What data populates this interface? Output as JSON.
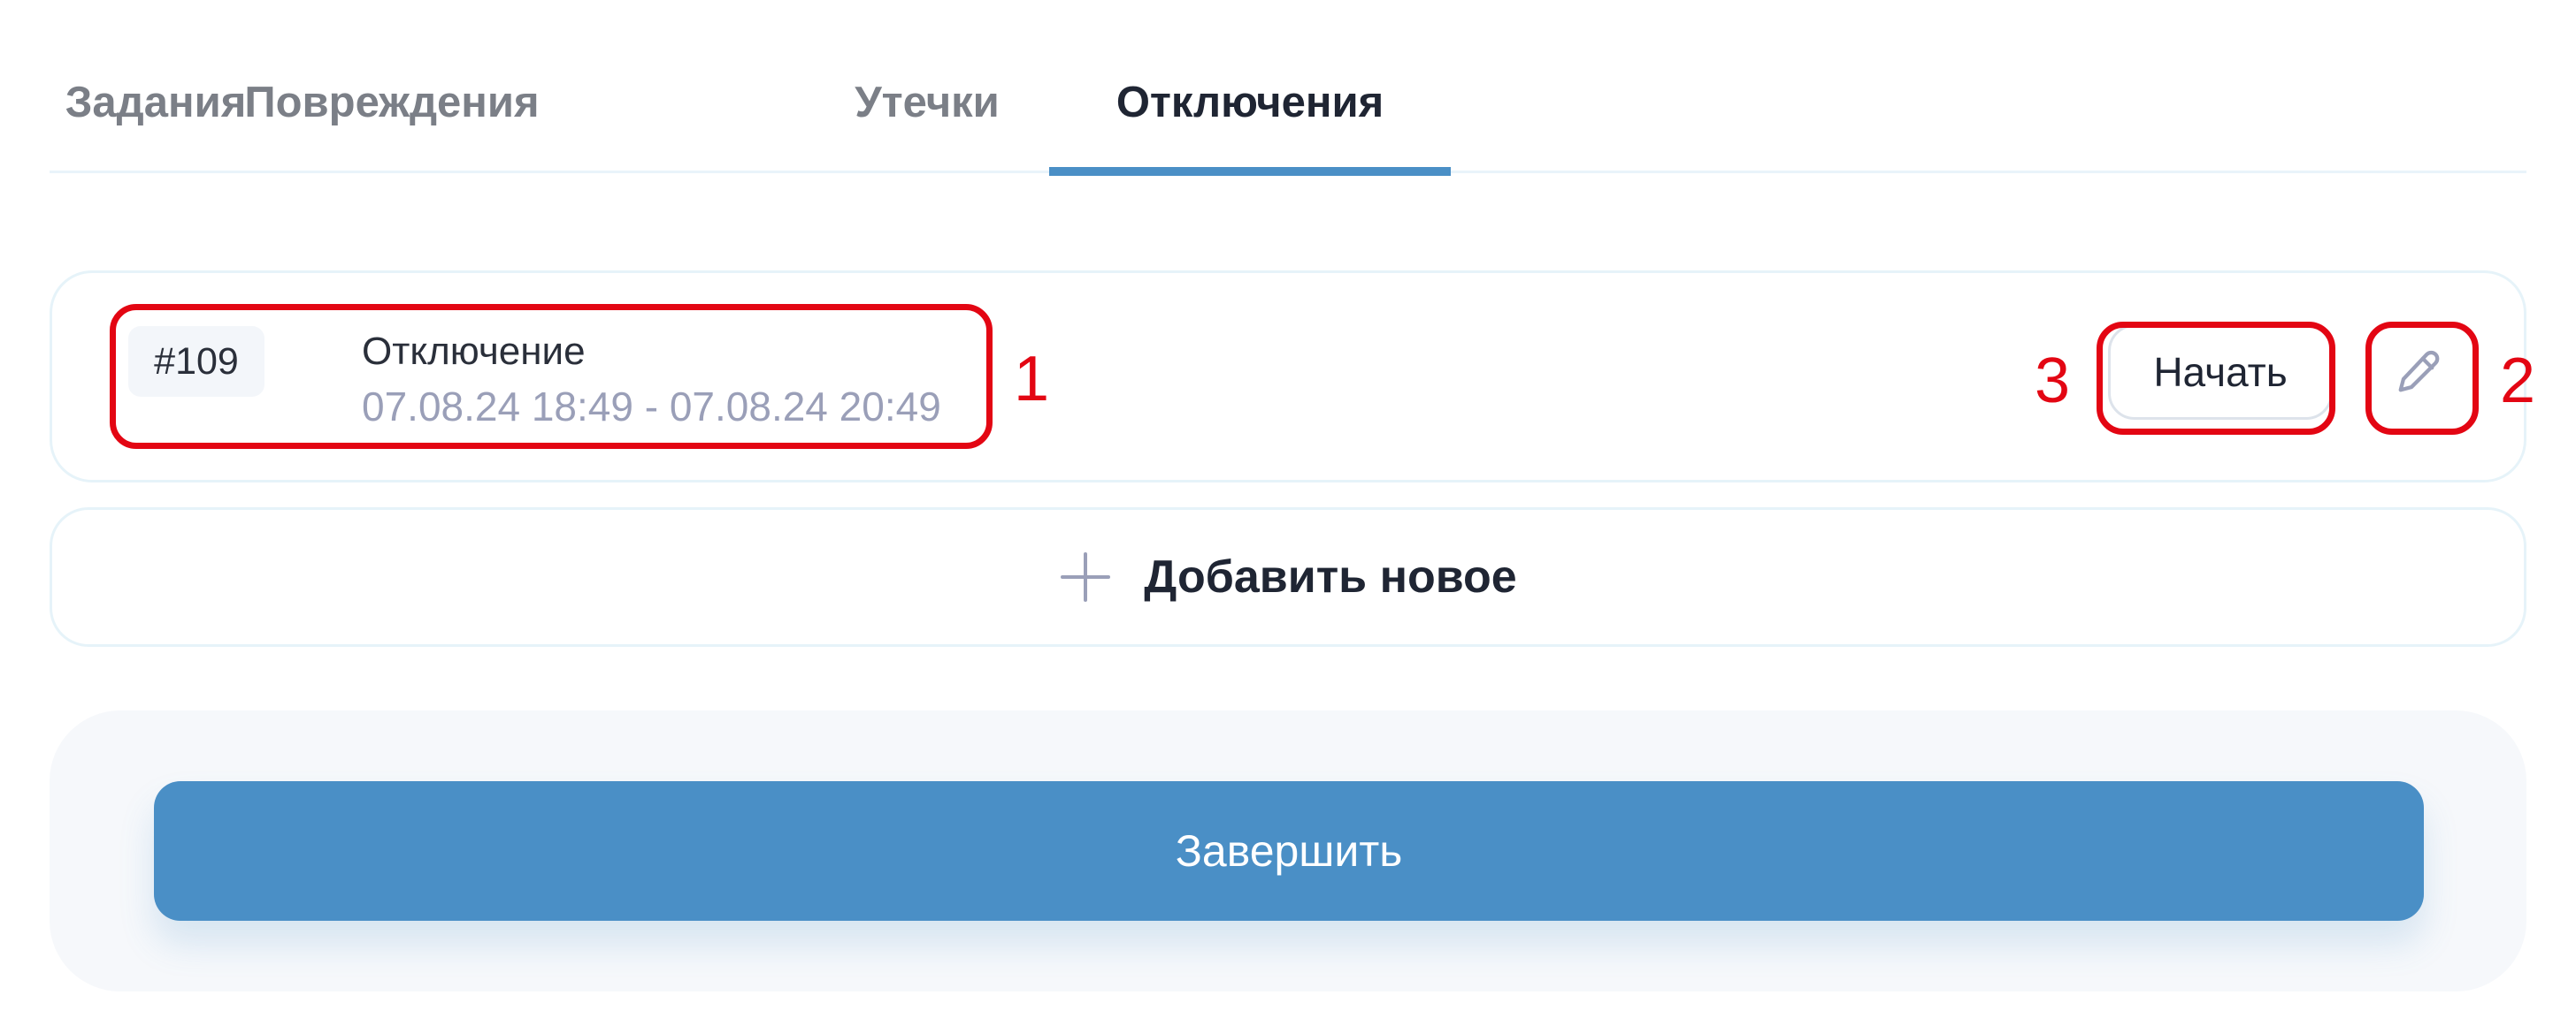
{
  "tabs": [
    {
      "label": "Задания",
      "active": false
    },
    {
      "label": "Повреждения",
      "active": false
    },
    {
      "label": "Утечки",
      "active": false
    },
    {
      "label": "Отключения",
      "active": true
    }
  ],
  "outage_item": {
    "id_badge": "#109",
    "title": "Отключение",
    "time_range": "07.08.24 18:49 - 07.08.24 20:49",
    "start_label": "Начать",
    "edit_icon": "pencil-icon"
  },
  "add_new": {
    "label": "Добавить новое",
    "icon": "plus-icon"
  },
  "finish_label": "Завершить",
  "annotations": {
    "item_marker": "1",
    "edit_marker": "2",
    "start_marker": "3"
  },
  "colors": {
    "accent": "#4a8fc6",
    "annotation": "#e30613",
    "muted_text": "#9a9fb8",
    "inactive_tab": "#7b7f87"
  }
}
